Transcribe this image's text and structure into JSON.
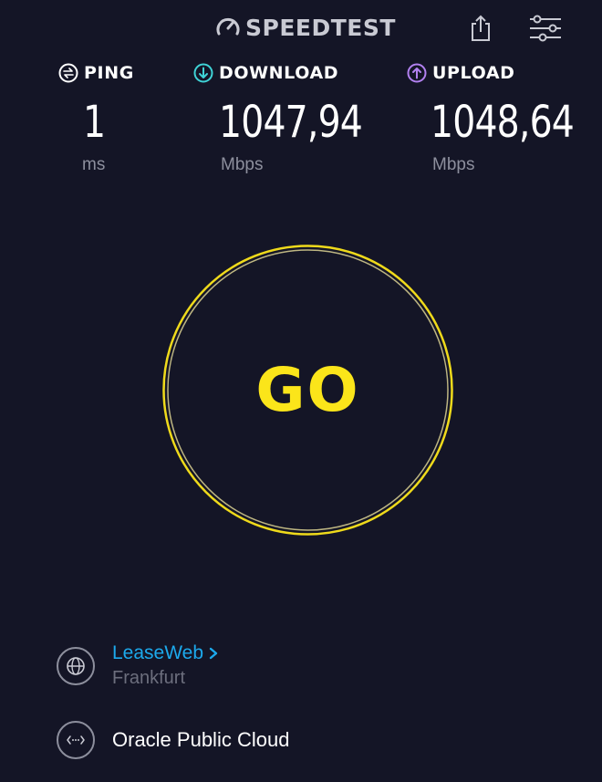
{
  "app": {
    "logo_text": "SPEEDTEST"
  },
  "header": {
    "icons": [
      "speedometer-icon",
      "share-icon",
      "settings-sliders-icon"
    ]
  },
  "metrics": {
    "ping": {
      "label": "PING",
      "value": "1",
      "unit": "ms",
      "icon": "ping-icon"
    },
    "download": {
      "label": "DOWNLOAD",
      "value": "1047,94",
      "unit": "Mbps",
      "icon": "download-arrow-icon"
    },
    "upload": {
      "label": "UPLOAD",
      "value": "1048,64",
      "unit": "Mbps",
      "icon": "upload-arrow-icon"
    }
  },
  "go_button": {
    "label": "GO"
  },
  "server": {
    "provider": "LeaseWeb",
    "city": "Frankfurt",
    "provider_icon": "globe-icon"
  },
  "isp": {
    "name": "Oracle Public Cloud",
    "icon": "connection-icon"
  },
  "colors": {
    "background": "#141526",
    "go_yellow": "#fbe51a",
    "download_teal": "#3fd3d6",
    "upload_purple": "#b281f0",
    "link_blue": "#1ca9ec",
    "muted_gray": "#8d8f9d"
  }
}
